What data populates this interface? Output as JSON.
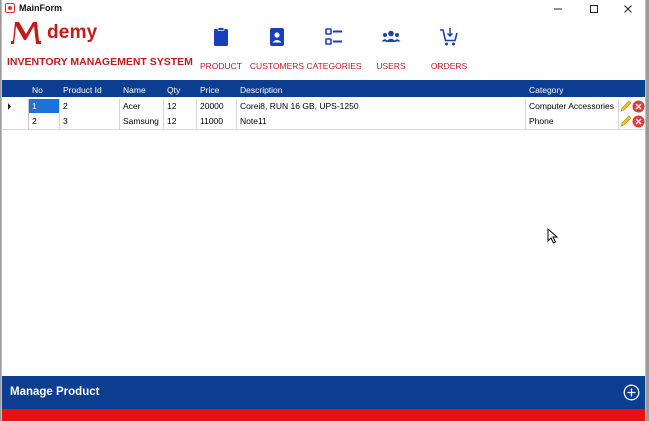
{
  "window": {
    "title": "MainForm"
  },
  "brand": {
    "logo_letter": "M",
    "logo_text": "demy",
    "system_name": "INVENTORY MANAGEMENT SYSTEM"
  },
  "nav": [
    {
      "label": "PRODUCT",
      "icon": "clipboard-icon"
    },
    {
      "label": "CUSTOMERS",
      "icon": "id-card-icon"
    },
    {
      "label": "CATEGORIES",
      "icon": "list-icon"
    },
    {
      "label": "USERS",
      "icon": "users-icon"
    },
    {
      "label": "ORDERS",
      "icon": "cart-icon"
    }
  ],
  "table": {
    "columns": [
      "No",
      "Product Id",
      "Name",
      "Qty",
      "Price",
      "Description",
      "Category"
    ],
    "rows": [
      {
        "no": "1",
        "product_id": "2",
        "name": "Acer",
        "qty": "12",
        "price": "20000",
        "description": "Corei8, RUN 16 GB, UPS-1250",
        "category": "Computer Accessories"
      },
      {
        "no": "2",
        "product_id": "3",
        "name": "Samsung",
        "qty": "12",
        "price": "11000",
        "description": "Note11",
        "category": "Phone"
      }
    ]
  },
  "footer": {
    "title": "Manage Product"
  },
  "colors": {
    "primary": "#0b3d91",
    "accent": "#c41a1a",
    "danger": "#e81010"
  }
}
